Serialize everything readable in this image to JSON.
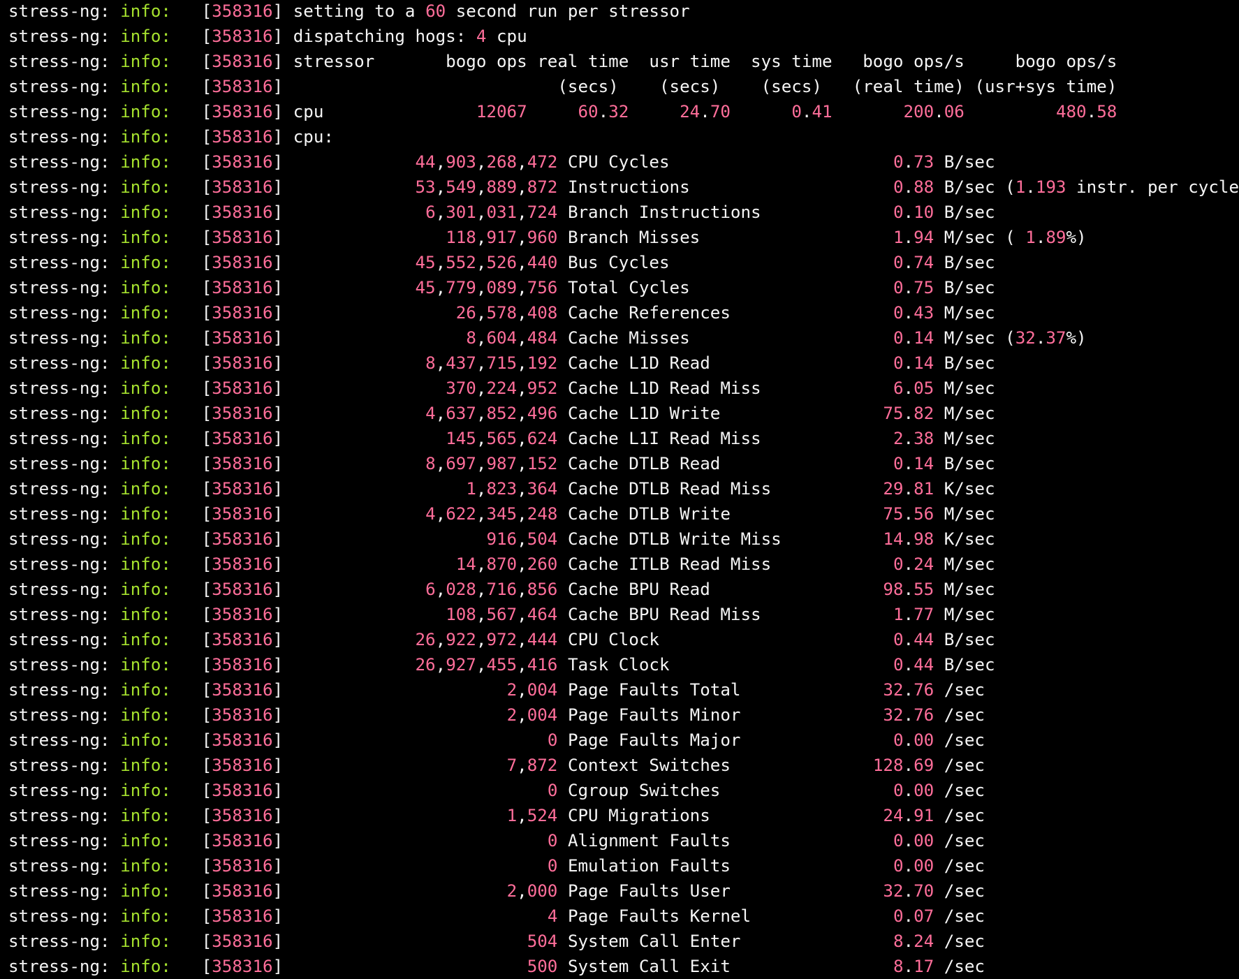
{
  "colors": {
    "background": "#000000",
    "text": "#f5f5f5",
    "level": "#a6e22e",
    "number": "#ff6e9a"
  },
  "program": "stress-ng:",
  "level": "info:",
  "pid": "358316",
  "lines": [
    {
      "id": "setting",
      "segments": [
        [
          "t",
          "setting to a "
        ],
        [
          "n",
          "60"
        ],
        [
          "t",
          " second run per stressor"
        ]
      ]
    },
    {
      "id": "dispatch",
      "segments": [
        [
          "t",
          "dispatching hogs: "
        ],
        [
          "n",
          "4"
        ],
        [
          "t",
          " cpu"
        ]
      ]
    },
    {
      "id": "header-1",
      "segments": [
        [
          "t",
          "stressor       bogo ops real time  usr time  sys time   bogo ops/s     bogo ops/s"
        ]
      ]
    },
    {
      "id": "header-2",
      "segments": [
        [
          "t",
          "                          (secs)    (secs)    (secs)   (real time) (usr+sys time)"
        ]
      ]
    },
    {
      "id": "cpu-summary",
      "segments": [
        [
          "t",
          "cpu               "
        ],
        [
          "n",
          "12067"
        ],
        [
          "t",
          "     "
        ],
        [
          "n",
          "60"
        ],
        [
          "t",
          "."
        ],
        [
          "n",
          "32"
        ],
        [
          "t",
          "     "
        ],
        [
          "n",
          "24"
        ],
        [
          "t",
          "."
        ],
        [
          "n",
          "70"
        ],
        [
          "t",
          "      "
        ],
        [
          "n",
          "0"
        ],
        [
          "t",
          "."
        ],
        [
          "n",
          "41"
        ],
        [
          "t",
          "       "
        ],
        [
          "n",
          "200"
        ],
        [
          "t",
          "."
        ],
        [
          "n",
          "06"
        ],
        [
          "t",
          "         "
        ],
        [
          "n",
          "480"
        ],
        [
          "t",
          "."
        ],
        [
          "n",
          "58"
        ]
      ]
    },
    {
      "id": "cpu-label",
      "segments": [
        [
          "t",
          "cpu:"
        ]
      ]
    }
  ],
  "metrics": [
    {
      "count": "44,903,268,472",
      "name": "CPU Cycles",
      "rate": "0.73",
      "unit": "B/sec",
      "extra": []
    },
    {
      "count": "53,549,889,872",
      "name": "Instructions",
      "rate": "0.88",
      "unit": "B/sec",
      "extra": [
        [
          "t",
          " ("
        ],
        [
          "n",
          "1"
        ],
        [
          "t",
          "."
        ],
        [
          "n",
          "193"
        ],
        [
          "t",
          " instr. per cycle)"
        ]
      ]
    },
    {
      "count": "6,301,031,724",
      "name": "Branch Instructions",
      "rate": "0.10",
      "unit": "B/sec",
      "extra": []
    },
    {
      "count": "118,917,960",
      "name": "Branch Misses",
      "rate": "1.94",
      "unit": "M/sec",
      "extra": [
        [
          "t",
          " ( "
        ],
        [
          "n",
          "1"
        ],
        [
          "t",
          "."
        ],
        [
          "n",
          "89"
        ],
        [
          "t",
          "%)"
        ]
      ]
    },
    {
      "count": "45,552,526,440",
      "name": "Bus Cycles",
      "rate": "0.74",
      "unit": "B/sec",
      "extra": []
    },
    {
      "count": "45,779,089,756",
      "name": "Total Cycles",
      "rate": "0.75",
      "unit": "B/sec",
      "extra": []
    },
    {
      "count": "26,578,408",
      "name": "Cache References",
      "rate": "0.43",
      "unit": "M/sec",
      "extra": []
    },
    {
      "count": "8,604,484",
      "name": "Cache Misses",
      "rate": "0.14",
      "unit": "M/sec",
      "extra": [
        [
          "t",
          " ("
        ],
        [
          "n",
          "32"
        ],
        [
          "t",
          "."
        ],
        [
          "n",
          "37"
        ],
        [
          "t",
          "%)"
        ]
      ]
    },
    {
      "count": "8,437,715,192",
      "name": "Cache L1D Read",
      "rate": "0.14",
      "unit": "B/sec",
      "extra": []
    },
    {
      "count": "370,224,952",
      "name": "Cache L1D Read Miss",
      "rate": "6.05",
      "unit": "M/sec",
      "extra": []
    },
    {
      "count": "4,637,852,496",
      "name": "Cache L1D Write",
      "rate": "75.82",
      "unit": "M/sec",
      "extra": []
    },
    {
      "count": "145,565,624",
      "name": "Cache L1I Read Miss",
      "rate": "2.38",
      "unit": "M/sec",
      "extra": []
    },
    {
      "count": "8,697,987,152",
      "name": "Cache DTLB Read",
      "rate": "0.14",
      "unit": "B/sec",
      "extra": []
    },
    {
      "count": "1,823,364",
      "name": "Cache DTLB Read Miss",
      "rate": "29.81",
      "unit": "K/sec",
      "extra": []
    },
    {
      "count": "4,622,345,248",
      "name": "Cache DTLB Write",
      "rate": "75.56",
      "unit": "M/sec",
      "extra": []
    },
    {
      "count": "916,504",
      "name": "Cache DTLB Write Miss",
      "rate": "14.98",
      "unit": "K/sec",
      "extra": []
    },
    {
      "count": "14,870,260",
      "name": "Cache ITLB Read Miss",
      "rate": "0.24",
      "unit": "M/sec",
      "extra": []
    },
    {
      "count": "6,028,716,856",
      "name": "Cache BPU Read",
      "rate": "98.55",
      "unit": "M/sec",
      "extra": []
    },
    {
      "count": "108,567,464",
      "name": "Cache BPU Read Miss",
      "rate": "1.77",
      "unit": "M/sec",
      "extra": []
    },
    {
      "count": "26,922,972,444",
      "name": "CPU Clock",
      "rate": "0.44",
      "unit": "B/sec",
      "extra": []
    },
    {
      "count": "26,927,455,416",
      "name": "Task Clock",
      "rate": "0.44",
      "unit": "B/sec",
      "extra": []
    },
    {
      "count": "2,004",
      "name": "Page Faults Total",
      "rate": "32.76",
      "unit": "/sec",
      "extra": []
    },
    {
      "count": "2,004",
      "name": "Page Faults Minor",
      "rate": "32.76",
      "unit": "/sec",
      "extra": []
    },
    {
      "count": "0",
      "name": "Page Faults Major",
      "rate": "0.00",
      "unit": "/sec",
      "extra": []
    },
    {
      "count": "7,872",
      "name": "Context Switches",
      "rate": "128.69",
      "unit": "/sec",
      "extra": []
    },
    {
      "count": "0",
      "name": "Cgroup Switches",
      "rate": "0.00",
      "unit": "/sec",
      "extra": []
    },
    {
      "count": "1,524",
      "name": "CPU Migrations",
      "rate": "24.91",
      "unit": "/sec",
      "extra": []
    },
    {
      "count": "0",
      "name": "Alignment Faults",
      "rate": "0.00",
      "unit": "/sec",
      "extra": []
    },
    {
      "count": "0",
      "name": "Emulation Faults",
      "rate": "0.00",
      "unit": "/sec",
      "extra": []
    },
    {
      "count": "2,000",
      "name": "Page Faults User",
      "rate": "32.70",
      "unit": "/sec",
      "extra": []
    },
    {
      "count": "4",
      "name": "Page Faults Kernel",
      "rate": "0.07",
      "unit": "/sec",
      "extra": []
    },
    {
      "count": "504",
      "name": "System Call Enter",
      "rate": "8.24",
      "unit": "/sec",
      "extra": []
    },
    {
      "count": "500",
      "name": "System Call Exit",
      "rate": "8.17",
      "unit": "/sec",
      "extra": []
    }
  ]
}
